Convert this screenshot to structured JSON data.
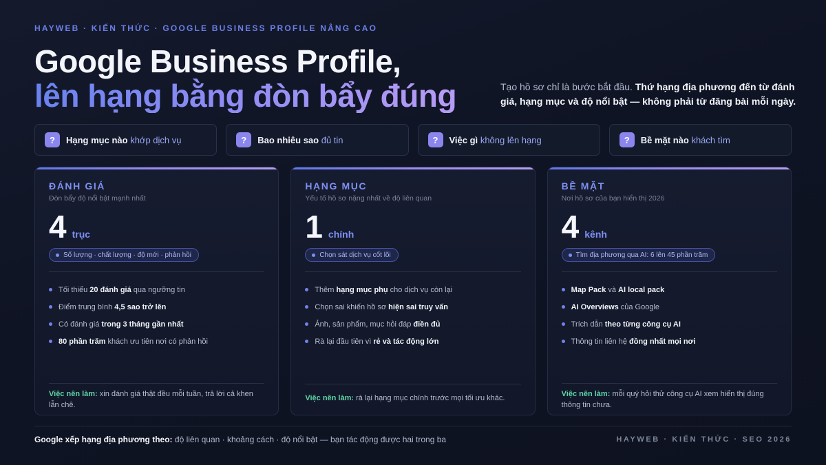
{
  "kicker": "HAYWEB · KIẾN THỨC · GOOGLE BUSINESS PROFILE NÂNG CAO",
  "title": {
    "line1": "Google Business Profile,",
    "line2": "lên hạng bằng đòn bẩy đúng"
  },
  "lede": {
    "plain": "Tạo hồ sơ chỉ là bước bắt đầu.",
    "bold": "Thứ hạng địa phương đến từ đánh giá, hạng mục và độ nổi bật — không phải từ đăng bài mỗi ngày."
  },
  "questions": [
    {
      "icon": "?",
      "bold": "Hạng mục nào",
      "rest": "khớp dịch vụ"
    },
    {
      "icon": "?",
      "bold": "Bao nhiêu sao",
      "rest": "đủ tin"
    },
    {
      "icon": "?",
      "bold": "Việc gì",
      "rest": "không lên hạng"
    },
    {
      "icon": "?",
      "bold": "Bề mặt nào",
      "rest": "khách tìm"
    }
  ],
  "cards": [
    {
      "title": "ĐÁNH GIÁ",
      "subtitle": "Đòn bẩy độ nổi bật mạnh nhất",
      "number": "4",
      "unit": "trục",
      "pill": "Số lượng · chất lượng · độ mới · phản hồi",
      "bullets": [
        {
          "pre": "Tối thiểu",
          "bold": "20 đánh giá",
          "post": "qua ngưỡng tin"
        },
        {
          "pre": "Điểm trung bình",
          "bold": "4,5 sao trở lên",
          "post": ""
        },
        {
          "pre": "Có đánh giá",
          "bold": "trong 3 tháng gần nhất",
          "post": ""
        },
        {
          "pre": "",
          "bold": "80 phần trăm",
          "post": "khách ưu tiên nơi có phản hồi"
        }
      ],
      "foot_tag": "Việc nên làm:",
      "foot_text": "xin đánh giá thật đều mỗi tuần, trả lời cả khen lẫn chê."
    },
    {
      "title": "HẠNG MỤC",
      "subtitle": "Yếu tố hồ sơ nặng nhất về độ liên quan",
      "number": "1",
      "unit": "chính",
      "pill": "Chọn sát dịch vụ cốt lõi",
      "bullets": [
        {
          "pre": "Thêm",
          "bold": "hạng mục phụ",
          "post": "cho dịch vụ còn lại"
        },
        {
          "pre": "Chọn sai khiến hồ sơ",
          "bold": "hiện sai truy vấn",
          "post": ""
        },
        {
          "pre": "Ảnh, sản phẩm, mục hỏi đáp",
          "bold": "điền đủ",
          "post": ""
        },
        {
          "pre": "Rà lại đầu tiên vì",
          "bold": "rẻ và tác động lớn",
          "post": ""
        }
      ],
      "foot_tag": "Việc nên làm:",
      "foot_text": "rà lại hạng mục chính trước mọi tối ưu khác."
    },
    {
      "title": "BỀ MẶT",
      "subtitle": "Nơi hồ sơ của bạn hiển thị 2026",
      "number": "4",
      "unit": "kênh",
      "pill": "Tìm địa phương qua AI: 6 lên 45 phần trăm",
      "bullets": [
        {
          "pre": "",
          "bold": "Map Pack",
          "post": "và",
          "bold2": "AI local pack"
        },
        {
          "pre": "",
          "bold": "AI Overviews",
          "post": "của Google"
        },
        {
          "pre": "Trích dẫn",
          "bold": "theo từng công cụ AI",
          "post": ""
        },
        {
          "pre": "Thông tin liên hệ",
          "bold": "đồng nhất mọi nơi",
          "post": ""
        }
      ],
      "foot_tag": "Việc nên làm:",
      "foot_text": "mỗi quý hỏi thử công cụ AI xem hiển thị đúng thông tin chưa."
    }
  ],
  "footer": {
    "left_bold": "Google xếp hạng địa phương theo:",
    "left_rest": "độ liên quan · khoảng cách · độ nổi bật — bạn tác động được hai trong ba",
    "right": "HAYWEB · KIẾN THỨC · SEO 2026"
  },
  "colors": {
    "accent": "#7d90f2",
    "accent_purple": "#8b86ee",
    "action_green": "#5fd3a6",
    "background": "#0f1424"
  }
}
